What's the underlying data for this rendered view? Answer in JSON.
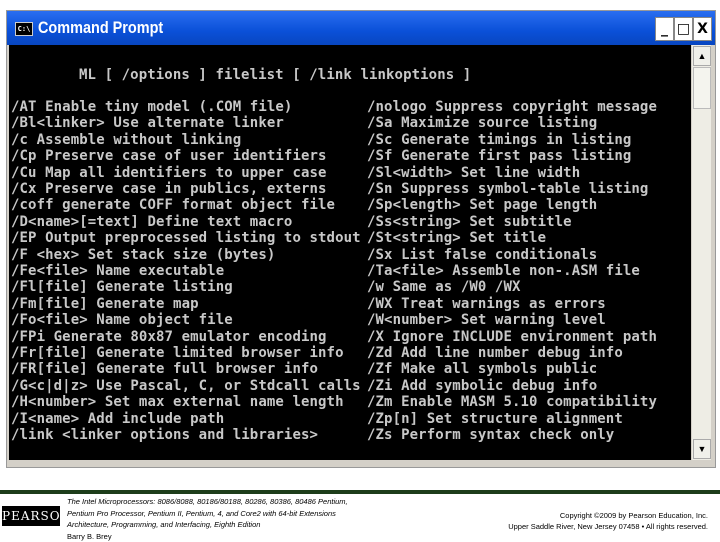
{
  "window": {
    "title": "Command Prompt",
    "icon": "cmd-icon",
    "controls": [
      "_",
      "□",
      "X"
    ]
  },
  "console": {
    "usage": "ML [ /options ] filelist [ /link linkoptions ]",
    "left": [
      "/AT Enable tiny model (.COM file)",
      "/Bl<linker> Use alternate linker",
      "/c Assemble without linking",
      "/Cp Preserve case of user identifiers",
      "/Cu Map all identifiers to upper case",
      "/Cx Preserve case in publics, externs",
      "/coff generate COFF format object file",
      "/D<name>[=text] Define text macro",
      "/EP Output preprocessed listing to stdout",
      "/F <hex> Set stack size (bytes)",
      "/Fe<file> Name executable",
      "/Fl[file] Generate listing",
      "/Fm[file] Generate map",
      "/Fo<file> Name object file",
      "/FPi Generate 80x87 emulator encoding",
      "/Fr[file] Generate limited browser info",
      "/FR[file] Generate full browser info",
      "/G<c|d|z> Use Pascal, C, or Stdcall calls",
      "/H<number> Set max external name length",
      "/I<name> Add include path",
      "/link <linker options and libraries>"
    ],
    "right": [
      "/nologo Suppress copyright message",
      "/Sa Maximize source listing",
      "/Sc Generate timings in listing",
      "/Sf Generate first pass listing",
      "/Sl<width> Set line width",
      "/Sn Suppress symbol-table listing",
      "/Sp<length> Set page length",
      "/Ss<string> Set subtitle",
      "/St<string> Set title",
      "/Sx List false conditionals",
      "/Ta<file> Assemble non-.ASM file",
      "/w Same as /W0 /WX",
      "/WX Treat warnings as errors",
      "/W<number> Set warning level",
      "/X Ignore INCLUDE environment path",
      "/Zd Add line number debug info",
      "/Zf Make all symbols public",
      "/Zi Add symbolic debug info",
      "/Zm Enable MASM 5.10 compatibility",
      "/Zp[n] Set structure alignment",
      "/Zs Perform syntax check only"
    ]
  },
  "footer": {
    "logo": "PEARSON",
    "book_lines": [
      "The Intel Microprocessors: 8086/8088, 80186/80188, 80286, 80386, 80486 Pentium,",
      "Pentium Pro Processor, Pentium II, Pentium, 4, and Core2 with 64-bit Extensions",
      "Architecture, Programming, and Interfacing, Eighth Edition",
      "Barry B. Brey"
    ],
    "copyright_lines": [
      "Copyright ©2009 by Pearson Education, Inc.",
      "Upper Saddle River, New Jersey 07458 • All rights reserved."
    ]
  }
}
